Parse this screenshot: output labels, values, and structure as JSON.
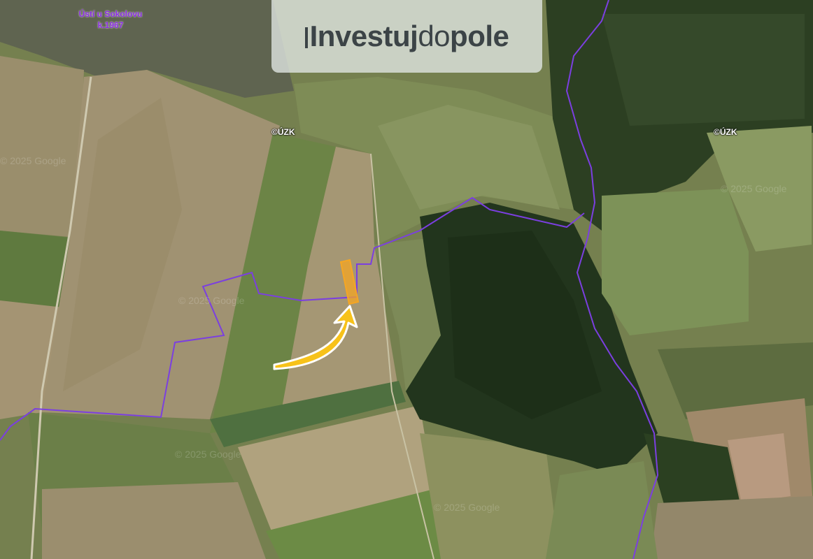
{
  "logo": {
    "part1": "Investuj",
    "part2": "do",
    "part3": "pole"
  },
  "village_label": {
    "line1": "Ústí u Sokolovu",
    "line2": "k.1967"
  },
  "attribution": [
    "©ÚZK",
    "©ÚZK"
  ],
  "watermarks": [
    "© 2025 Google",
    "© 2025 Google",
    "© 2025 Google",
    "© 2025 Google",
    "© 2025 Google"
  ],
  "colors": {
    "boundary": "#7b3fe0",
    "parcel": "#f5a623",
    "arrow": "#f7c21a"
  }
}
